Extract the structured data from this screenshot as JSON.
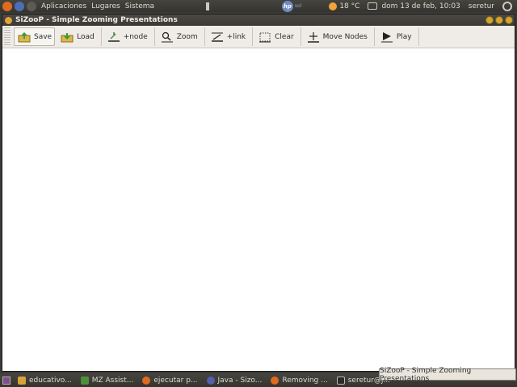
{
  "top_panel": {
    "menus": [
      "Aplicaciones",
      "Lugares",
      "Sistema"
    ],
    "weather": "18 °C",
    "datetime": "dom 13 de feb, 10:03",
    "user": "seretur"
  },
  "window": {
    "title": "SiZooP - Simple Zooming Presentations"
  },
  "toolbar": {
    "buttons": [
      {
        "label": "Save",
        "icon": "save-icon"
      },
      {
        "label": "Load",
        "icon": "load-icon"
      },
      {
        "label": "+node",
        "icon": "add-node-icon"
      },
      {
        "label": "Zoom",
        "icon": "zoom-icon"
      },
      {
        "label": "+link",
        "icon": "add-link-icon"
      },
      {
        "label": "Clear",
        "icon": "clear-icon"
      },
      {
        "label": "Move Nodes",
        "icon": "move-icon"
      },
      {
        "label": "Play",
        "icon": "play-icon"
      }
    ]
  },
  "taskbar": {
    "tasks": [
      {
        "label": "educativo...",
        "color": "#d8a23a"
      },
      {
        "label": "MZ Assist...",
        "color": "#4f8f3c"
      },
      {
        "label": "ejecutar p...",
        "color": "#e06b1f"
      },
      {
        "label": "Java - Sizo...",
        "color": "#5460a8"
      },
      {
        "label": "Removing ...",
        "color": "#e06b1f"
      },
      {
        "label": "seretur@j...",
        "color": "#3a3a3a"
      }
    ],
    "tooltip": "SiZooP - Simple Zooming Presentations"
  }
}
